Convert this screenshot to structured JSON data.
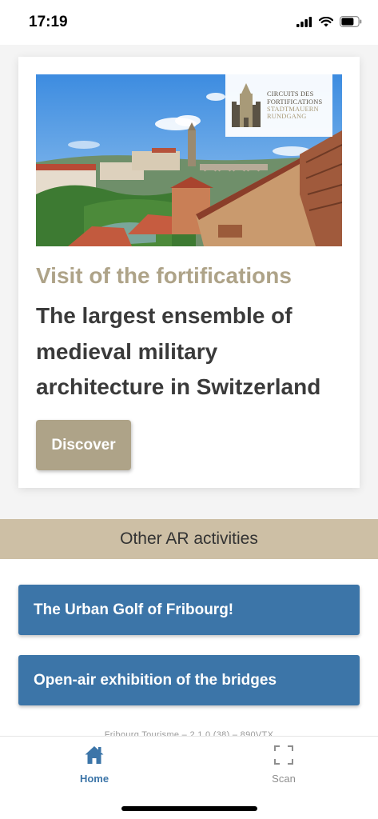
{
  "status_bar": {
    "time": "17:19"
  },
  "hero": {
    "logo_lines": [
      "CIRCUITS DES",
      "FORTIFICATIONS",
      "STADTMAUERN",
      "RUNDGANG"
    ]
  },
  "card": {
    "subtitle": "Visit of the fortifications",
    "title": "The largest ensemble of medieval military architecture in Switzerland",
    "button_label": "Discover"
  },
  "other_activities": {
    "header": "Other AR activities",
    "items": [
      {
        "label": "The Urban Golf of Fribourg!"
      },
      {
        "label": "Open-air exhibition of the bridges"
      }
    ]
  },
  "footer": {
    "version_text": "Fribourg Tourisme – 2.1.0 (38) – 890VTX"
  },
  "tab_bar": {
    "tabs": [
      {
        "label": "Home",
        "icon": "home-icon"
      },
      {
        "label": "Scan",
        "icon": "scan-icon"
      }
    ]
  },
  "colors": {
    "accent_gold": "#aea388",
    "brand_blue": "#3c75a8",
    "section_header_bg": "#cdbfa5"
  }
}
